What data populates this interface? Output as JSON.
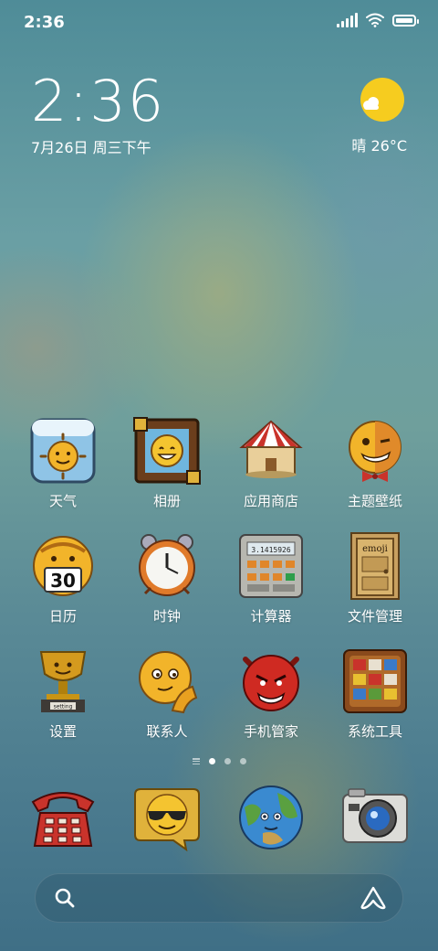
{
  "status_bar": {
    "time": "2:36"
  },
  "clock_widget": {
    "time": "2:36",
    "date": "7月26日 周三下午"
  },
  "weather_widget": {
    "text": "晴 26°C",
    "icon": "sun-cloud-icon"
  },
  "apps": [
    {
      "label": "天气",
      "icon": "weather-icon"
    },
    {
      "label": "相册",
      "icon": "gallery-icon"
    },
    {
      "label": "应用商店",
      "icon": "app-store-icon"
    },
    {
      "label": "主题壁纸",
      "icon": "themes-icon"
    },
    {
      "label": "日历",
      "icon": "calendar-icon",
      "icon_text": "30"
    },
    {
      "label": "时钟",
      "icon": "clock-icon"
    },
    {
      "label": "计算器",
      "icon": "calculator-icon",
      "icon_text": "3.1415926"
    },
    {
      "label": "文件管理",
      "icon": "file-manager-icon",
      "icon_text": "emoji"
    },
    {
      "label": "设置",
      "icon": "settings-icon",
      "icon_text": "setting"
    },
    {
      "label": "联系人",
      "icon": "contacts-icon"
    },
    {
      "label": "手机管家",
      "icon": "security-icon"
    },
    {
      "label": "系统工具",
      "icon": "tools-icon"
    }
  ],
  "page_indicator": {
    "pages": 3,
    "active": 1
  },
  "dock": [
    {
      "icon": "phone-icon"
    },
    {
      "icon": "messages-icon"
    },
    {
      "icon": "browser-icon"
    },
    {
      "icon": "camera-icon"
    }
  ],
  "search_bar": {
    "left_icon": "search-icon",
    "right_icon": "assistant-icon"
  },
  "colors": {
    "accent_yellow": "#f4c430",
    "text": "#ffffff"
  }
}
